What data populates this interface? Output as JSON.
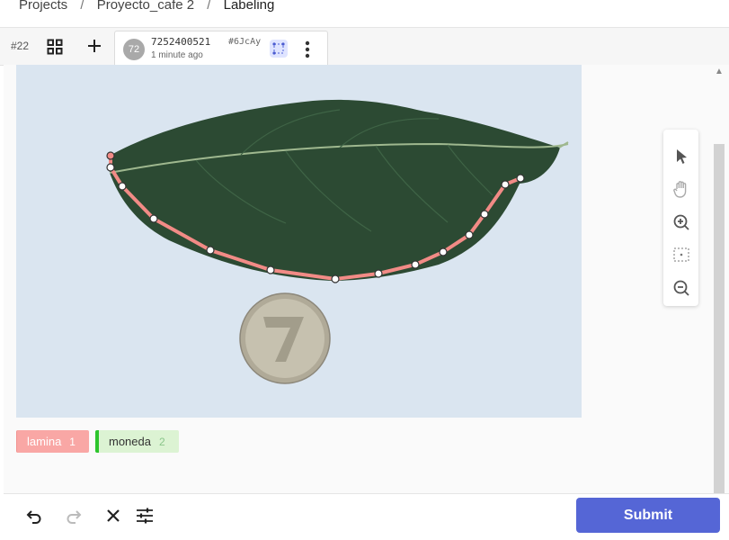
{
  "breadcrumbs": {
    "projects": "Projects",
    "project": "Proyecto_cafe 2",
    "current": "Labeling",
    "separator": "/"
  },
  "tabbar": {
    "task_number": "#22",
    "tab": {
      "avatar": "72",
      "id": "7252400521",
      "hash": "#6JcAy",
      "time": "1 minute ago"
    }
  },
  "labels": [
    {
      "name": "lamina",
      "count": "1",
      "color": "#f9a7a5"
    },
    {
      "name": "moneda",
      "count": "2",
      "color": "#2cc52c"
    }
  ],
  "toolbar_icons": [
    "cursor-icon",
    "hand-icon",
    "zoom-in-icon",
    "fit-icon",
    "zoom-out-icon"
  ],
  "bottom_icons": [
    "undo-icon",
    "redo-icon",
    "close-icon",
    "settings-icon"
  ],
  "submit_label": "Submit",
  "colors": {
    "accent": "#5566d6",
    "polygon": "#f28b86"
  }
}
